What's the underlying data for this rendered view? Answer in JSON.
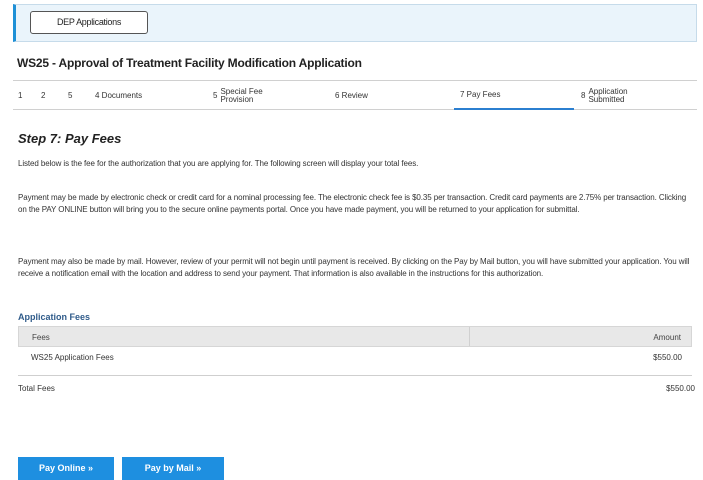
{
  "header": {
    "dep_button_label": "DEP Applications"
  },
  "application": {
    "title": "WS25 - Approval of Treatment Facility Modification Application"
  },
  "steps": [
    {
      "label": "1"
    },
    {
      "label": "2"
    },
    {
      "label": "5"
    },
    {
      "label": "4 Documents"
    },
    {
      "label": "Special Fee Provision",
      "prefix": "5"
    },
    {
      "label": "6 Review"
    },
    {
      "label": "7 Pay Fees",
      "active": true
    },
    {
      "label": "Application Submitted",
      "prefix": "8"
    }
  ],
  "main": {
    "heading": "Step 7: Pay Fees",
    "paragraphs": [
      "Listed below is the fee for the authorization that you are applying for. The following screen will display your total fees.",
      "Payment may be made by electronic check or credit card for a nominal processing fee. The electronic check fee is $0.35 per transaction. Credit card payments are 2.75% per transaction. Clicking on the PAY ONLINE button will bring you to the secure online payments portal. Once you have made payment, you will be returned to your application for submittal.",
      "Payment may also be made by mail. However, review of your permit will not begin until payment is received. By clicking on the Pay by Mail button, you will have submitted your application. You will receive a notification email with the location and address to send your payment. That information is also available in the instructions for this authorization."
    ]
  },
  "fees": {
    "section_title": "Application Fees",
    "columns": {
      "fees": "Fees",
      "amount": "Amount"
    },
    "rows": [
      {
        "name": "WS25 Application Fees",
        "amount": "$550.00"
      }
    ],
    "total_label": "Total Fees",
    "total_amount": "$550.00"
  },
  "actions": {
    "pay_online": "Pay Online »",
    "pay_by_mail": "Pay by Mail »",
    "accent_color": "#1e8fe0"
  }
}
